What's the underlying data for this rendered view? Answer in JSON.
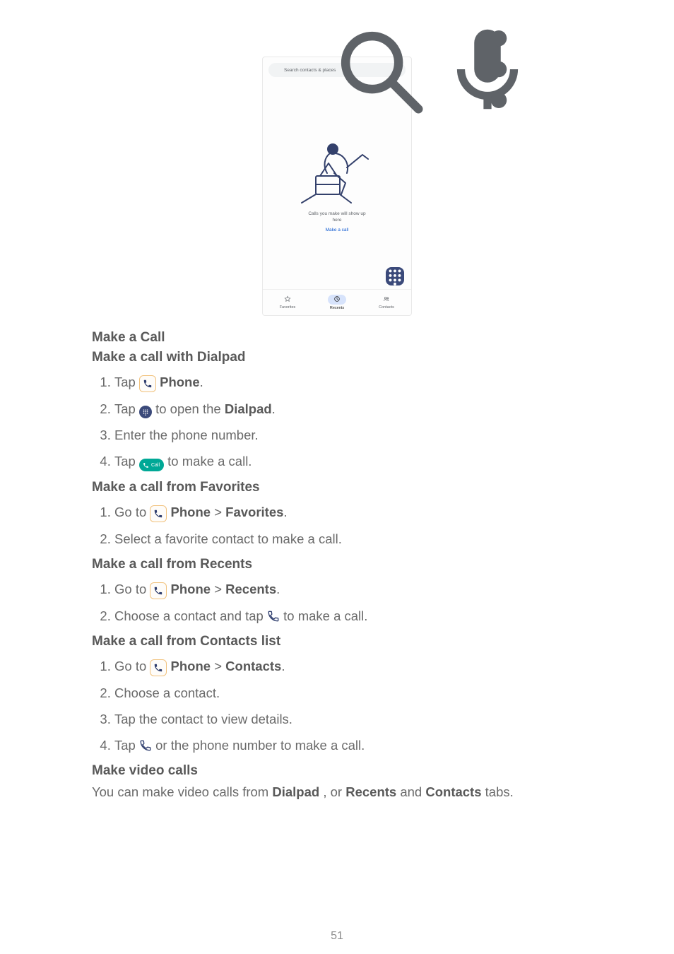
{
  "page_number": "51",
  "screenshot": {
    "search_placeholder": "Search contacts & places",
    "empty_state_line1": "Calls you make will show up",
    "empty_state_line2": "here",
    "empty_state_cta": "Make a call",
    "tabs": {
      "favorites": "Favorites",
      "recents": "Recents",
      "contacts": "Contacts"
    }
  },
  "sections": {
    "make_a_call": "Make a Call",
    "dialpad": {
      "title": "Make a call with Dialpad",
      "steps": {
        "s1_a": "Tap ",
        "s1_b": " Phone",
        "s1_c": ".",
        "s2_a": "Tap ",
        "s2_b": " to open the ",
        "s2_c": "Dialpad",
        "s2_d": ".",
        "s3": "Enter the phone number.",
        "s4_a": "Tap ",
        "s4_b": " to make a call."
      }
    },
    "favorites": {
      "title": "Make a call from Favorites",
      "steps": {
        "s1_a": "Go to ",
        "s1_b": "Phone",
        "s1_c": " > ",
        "s1_d": "Favorites",
        "s1_e": ".",
        "s2": "Select a favorite contact to make a call."
      }
    },
    "recents": {
      "title": "Make a call from Recents",
      "steps": {
        "s1_a": "Go to ",
        "s1_b": "Phone",
        "s1_c": " > ",
        "s1_d": "Recents",
        "s1_e": ".",
        "s2_a": "Choose a contact and tap ",
        "s2_b": " to make a call."
      }
    },
    "contacts": {
      "title": "Make a call from Contacts list",
      "steps": {
        "s1_a": "Go to ",
        "s1_b": "Phone",
        "s1_c": " > ",
        "s1_d": "Contacts",
        "s1_e": ".",
        "s2": "Choose a contact.",
        "s3": "Tap the contact to view details.",
        "s4_a": "Tap ",
        "s4_b": " or the phone number to make a call."
      }
    },
    "video": {
      "title": "Make video calls",
      "para_a": "You can make video calls from ",
      "para_b": "Dialpad",
      "para_c": " , or ",
      "para_d": "Recents",
      "para_e": " and ",
      "para_f": "Contacts",
      "para_g": " tabs."
    }
  },
  "inline_labels": {
    "call_chip": "Call"
  }
}
